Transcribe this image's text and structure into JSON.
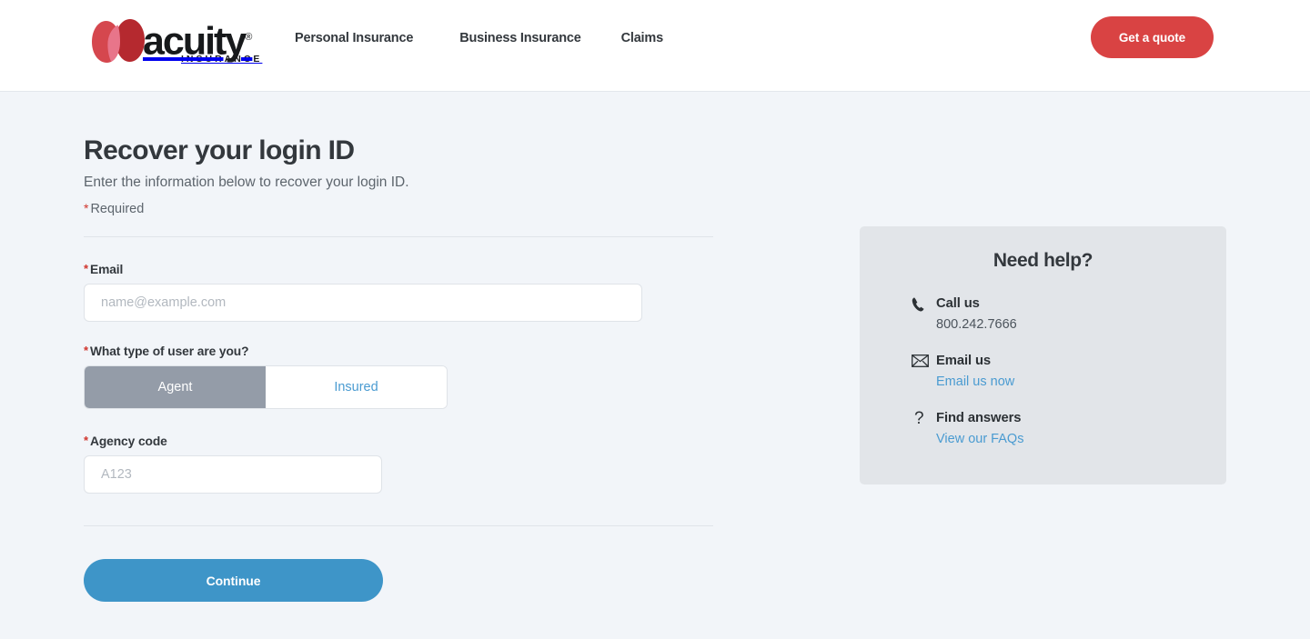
{
  "header": {
    "brand": {
      "name": "acuity",
      "registered": "®",
      "subtitle": "INSURANCE",
      "logo_colors": {
        "left_petal": "#d5474e",
        "right_petal": "#b5292f",
        "overlap": "#e8758a"
      }
    },
    "nav": [
      {
        "label": "Personal Insurance"
      },
      {
        "label": "Business Insurance"
      },
      {
        "label": "Claims"
      }
    ],
    "quote_button": {
      "label": "Get a quote",
      "color": "#d94343"
    }
  },
  "main": {
    "title": "Recover your login ID",
    "subtitle": "Enter the information below to recover your login ID.",
    "required_star": "*",
    "required_note": "Required",
    "fields": {
      "email": {
        "label": "Email",
        "value": "",
        "placeholder": "name@example.com"
      },
      "user_type": {
        "label": "What type of user are you?",
        "options": [
          {
            "label": "Agent",
            "selected": true
          },
          {
            "label": "Insured",
            "selected": false
          }
        ],
        "selected_value": "Agent"
      },
      "agency_code": {
        "label": "Agency code",
        "value": "",
        "placeholder": "A123"
      }
    },
    "submit_button": {
      "label": "Continue",
      "color": "#3e95c8"
    }
  },
  "help": {
    "title": "Need help?",
    "items": [
      {
        "icon": "phone-icon",
        "heading": "Call us",
        "value": "800.242.7666",
        "is_link": false
      },
      {
        "icon": "envelope-icon",
        "heading": "Email us",
        "value": "Email us now",
        "is_link": true
      },
      {
        "icon": "question-mark-icon",
        "heading": "Find answers",
        "value": "View our FAQs",
        "is_link": true
      }
    ],
    "link_color": "#4a9bd1",
    "panel_color": "#e2e5e9"
  }
}
